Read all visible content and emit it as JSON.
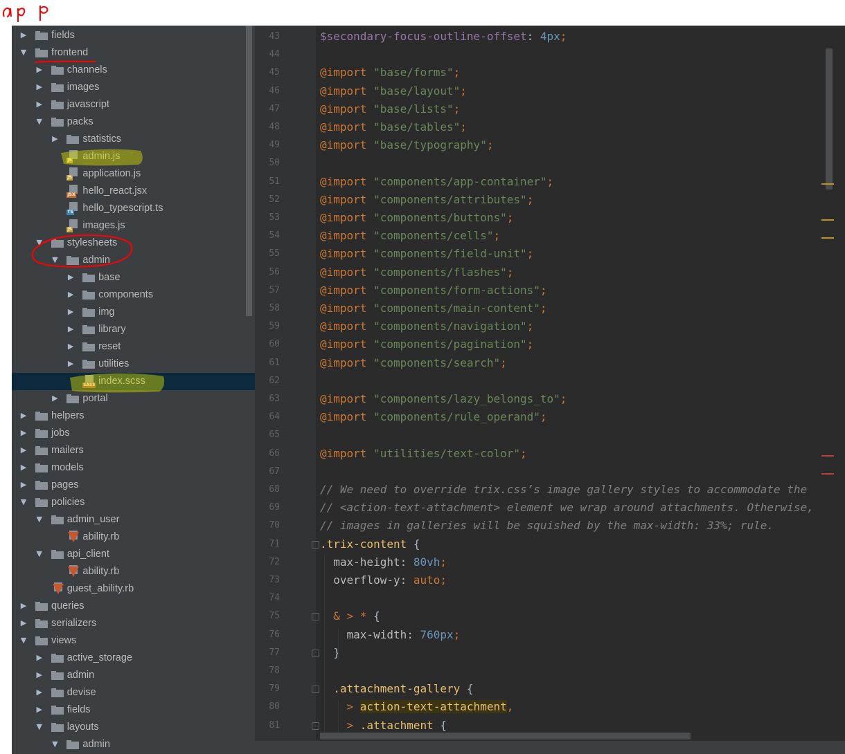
{
  "annotation": {
    "title": "app",
    "highlight_color": "#ffff00",
    "ink_color": "#ff0000"
  },
  "colors": {
    "sidebar_bg": "#3c3f41",
    "editor_bg": "#2b2b2b",
    "gutter_bg": "#313335",
    "selection_bg": "#0d293e"
  },
  "tree": [
    {
      "label": "fields",
      "depth": 0,
      "kind": "folder",
      "state": "collapsed"
    },
    {
      "label": "frontend",
      "depth": 0,
      "kind": "folder",
      "state": "expanded"
    },
    {
      "label": "channels",
      "depth": 1,
      "kind": "folder",
      "state": "collapsed"
    },
    {
      "label": "images",
      "depth": 1,
      "kind": "folder",
      "state": "collapsed"
    },
    {
      "label": "javascript",
      "depth": 1,
      "kind": "folder",
      "state": "collapsed"
    },
    {
      "label": "packs",
      "depth": 1,
      "kind": "folder",
      "state": "expanded"
    },
    {
      "label": "statistics",
      "depth": 2,
      "kind": "folder",
      "state": "collapsed"
    },
    {
      "label": "admin.js",
      "depth": 2,
      "kind": "file",
      "filetype": "JS",
      "icon": "js-file-icon",
      "highlight": true
    },
    {
      "label": "application.js",
      "depth": 2,
      "kind": "file",
      "filetype": "JS",
      "icon": "js-file-icon"
    },
    {
      "label": "hello_react.jsx",
      "depth": 2,
      "kind": "file",
      "filetype": "JSX",
      "icon": "jsx-file-icon"
    },
    {
      "label": "hello_typescript.ts",
      "depth": 2,
      "kind": "file",
      "filetype": "TS",
      "icon": "ts-file-icon"
    },
    {
      "label": "images.js",
      "depth": 2,
      "kind": "file",
      "filetype": "JS",
      "icon": "js-file-icon"
    },
    {
      "label": "stylesheets",
      "depth": 1,
      "kind": "folder",
      "state": "expanded"
    },
    {
      "label": "admin",
      "depth": 2,
      "kind": "folder",
      "state": "expanded"
    },
    {
      "label": "base",
      "depth": 3,
      "kind": "folder",
      "state": "collapsed"
    },
    {
      "label": "components",
      "depth": 3,
      "kind": "folder",
      "state": "collapsed"
    },
    {
      "label": "img",
      "depth": 3,
      "kind": "folder",
      "state": "collapsed"
    },
    {
      "label": "library",
      "depth": 3,
      "kind": "folder",
      "state": "collapsed"
    },
    {
      "label": "reset",
      "depth": 3,
      "kind": "folder",
      "state": "collapsed"
    },
    {
      "label": "utilities",
      "depth": 3,
      "kind": "folder",
      "state": "collapsed"
    },
    {
      "label": "index.scss",
      "depth": 3,
      "kind": "file",
      "filetype": "SASS",
      "icon": "sass-file-icon",
      "selected": true,
      "highlight": true
    },
    {
      "label": "portal",
      "depth": 2,
      "kind": "folder",
      "state": "collapsed"
    },
    {
      "label": "helpers",
      "depth": 0,
      "kind": "folder",
      "state": "collapsed"
    },
    {
      "label": "jobs",
      "depth": 0,
      "kind": "folder",
      "state": "collapsed"
    },
    {
      "label": "mailers",
      "depth": 0,
      "kind": "folder",
      "state": "collapsed"
    },
    {
      "label": "models",
      "depth": 0,
      "kind": "folder",
      "state": "collapsed"
    },
    {
      "label": "pages",
      "depth": 0,
      "kind": "folder",
      "state": "collapsed"
    },
    {
      "label": "policies",
      "depth": 0,
      "kind": "folder",
      "state": "expanded"
    },
    {
      "label": "admin_user",
      "depth": 1,
      "kind": "folder",
      "state": "expanded"
    },
    {
      "label": "ability.rb",
      "depth": 2,
      "kind": "file",
      "filetype": "RB",
      "icon": "ruby-file-icon"
    },
    {
      "label": "api_client",
      "depth": 1,
      "kind": "folder",
      "state": "expanded"
    },
    {
      "label": "ability.rb",
      "depth": 2,
      "kind": "file",
      "filetype": "RB",
      "icon": "ruby-file-icon"
    },
    {
      "label": "guest_ability.rb",
      "depth": 1,
      "kind": "file",
      "filetype": "RB",
      "icon": "ruby-file-icon"
    },
    {
      "label": "queries",
      "depth": 0,
      "kind": "folder",
      "state": "collapsed"
    },
    {
      "label": "serializers",
      "depth": 0,
      "kind": "folder",
      "state": "collapsed"
    },
    {
      "label": "views",
      "depth": 0,
      "kind": "folder",
      "state": "expanded"
    },
    {
      "label": "active_storage",
      "depth": 1,
      "kind": "folder",
      "state": "collapsed"
    },
    {
      "label": "admin",
      "depth": 1,
      "kind": "folder",
      "state": "collapsed"
    },
    {
      "label": "devise",
      "depth": 1,
      "kind": "folder",
      "state": "collapsed"
    },
    {
      "label": "fields",
      "depth": 1,
      "kind": "folder",
      "state": "collapsed"
    },
    {
      "label": "layouts",
      "depth": 1,
      "kind": "folder",
      "state": "expanded"
    },
    {
      "label": "admin",
      "depth": 2,
      "kind": "folder",
      "state": "expanded"
    }
  ],
  "editor": {
    "lines": [
      {
        "n": "43",
        "t": [
          [
            "var",
            "$secondary-focus-outline-offset"
          ],
          [
            "txt",
            ": "
          ],
          [
            "num",
            "4px"
          ],
          [
            "kw",
            ";"
          ]
        ]
      },
      {
        "n": "44",
        "t": []
      },
      {
        "n": "45",
        "t": [
          [
            "kw",
            "@import "
          ],
          [
            "str",
            "\"base/forms\""
          ],
          [
            "kw",
            ";"
          ]
        ]
      },
      {
        "n": "46",
        "t": [
          [
            "kw",
            "@import "
          ],
          [
            "str",
            "\"base/layout\""
          ],
          [
            "kw",
            ";"
          ]
        ]
      },
      {
        "n": "47",
        "t": [
          [
            "kw",
            "@import "
          ],
          [
            "str",
            "\"base/lists\""
          ],
          [
            "kw",
            ";"
          ]
        ]
      },
      {
        "n": "48",
        "t": [
          [
            "kw",
            "@import "
          ],
          [
            "str",
            "\"base/tables\""
          ],
          [
            "kw",
            ";"
          ]
        ]
      },
      {
        "n": "49",
        "t": [
          [
            "kw",
            "@import "
          ],
          [
            "str",
            "\"base/typography\""
          ],
          [
            "kw",
            ";"
          ]
        ]
      },
      {
        "n": "50",
        "t": []
      },
      {
        "n": "51",
        "t": [
          [
            "kw",
            "@import "
          ],
          [
            "str",
            "\"components/app-container\""
          ],
          [
            "kw",
            ";"
          ]
        ]
      },
      {
        "n": "52",
        "t": [
          [
            "kw",
            "@import "
          ],
          [
            "str",
            "\"components/attributes\""
          ],
          [
            "kw",
            ";"
          ]
        ]
      },
      {
        "n": "53",
        "t": [
          [
            "kw",
            "@import "
          ],
          [
            "str",
            "\"components/buttons\""
          ],
          [
            "kw",
            ";"
          ]
        ]
      },
      {
        "n": "54",
        "t": [
          [
            "kw",
            "@import "
          ],
          [
            "str",
            "\"components/cells\""
          ],
          [
            "kw",
            ";"
          ]
        ]
      },
      {
        "n": "55",
        "t": [
          [
            "kw",
            "@import "
          ],
          [
            "str",
            "\"components/field-unit\""
          ],
          [
            "kw",
            ";"
          ]
        ]
      },
      {
        "n": "56",
        "t": [
          [
            "kw",
            "@import "
          ],
          [
            "str",
            "\"components/flashes\""
          ],
          [
            "kw",
            ";"
          ]
        ]
      },
      {
        "n": "57",
        "t": [
          [
            "kw",
            "@import "
          ],
          [
            "str",
            "\"components/form-actions\""
          ],
          [
            "kw",
            ";"
          ]
        ]
      },
      {
        "n": "58",
        "t": [
          [
            "kw",
            "@import "
          ],
          [
            "str",
            "\"components/main-content\""
          ],
          [
            "kw",
            ";"
          ]
        ]
      },
      {
        "n": "59",
        "t": [
          [
            "kw",
            "@import "
          ],
          [
            "str",
            "\"components/navigation\""
          ],
          [
            "kw",
            ";"
          ]
        ]
      },
      {
        "n": "60",
        "t": [
          [
            "kw",
            "@import "
          ],
          [
            "str",
            "\"components/pagination\""
          ],
          [
            "kw",
            ";"
          ]
        ]
      },
      {
        "n": "61",
        "t": [
          [
            "kw",
            "@import "
          ],
          [
            "str",
            "\"components/search\""
          ],
          [
            "kw",
            ";"
          ]
        ]
      },
      {
        "n": "62",
        "t": []
      },
      {
        "n": "63",
        "t": [
          [
            "kw",
            "@import "
          ],
          [
            "str",
            "\"components/lazy_belongs_to\""
          ],
          [
            "kw",
            ";"
          ]
        ]
      },
      {
        "n": "64",
        "t": [
          [
            "kw",
            "@import "
          ],
          [
            "str",
            "\"components/rule_operand\""
          ],
          [
            "kw",
            ";"
          ]
        ]
      },
      {
        "n": "65",
        "t": []
      },
      {
        "n": "66",
        "t": [
          [
            "kw",
            "@import "
          ],
          [
            "str",
            "\"utilities/text-color\""
          ],
          [
            "kw",
            ";"
          ]
        ]
      },
      {
        "n": "67",
        "t": []
      },
      {
        "n": "68",
        "t": [
          [
            "com",
            "// We need to override trix.css’s image gallery styles to accommodate the"
          ]
        ]
      },
      {
        "n": "69",
        "t": [
          [
            "com",
            "// <action-text-attachment> element we wrap around attachments. Otherwise,"
          ]
        ]
      },
      {
        "n": "70",
        "t": [
          [
            "com",
            "// images in galleries will be squished by the max-width: 33%; rule."
          ]
        ]
      },
      {
        "n": "71",
        "t": [
          [
            "sel",
            ".trix-content"
          ],
          [
            "txt",
            " {"
          ]
        ]
      },
      {
        "n": "72",
        "t": [
          [
            "txt",
            "  "
          ],
          [
            "prop",
            "max-height"
          ],
          [
            "txt",
            ": "
          ],
          [
            "num",
            "80vh"
          ],
          [
            "kw",
            ";"
          ]
        ]
      },
      {
        "n": "73",
        "t": [
          [
            "txt",
            "  "
          ],
          [
            "prop",
            "overflow-y"
          ],
          [
            "txt",
            ": "
          ],
          [
            "kw",
            "auto"
          ],
          [
            "kw",
            ";"
          ]
        ]
      },
      {
        "n": "74",
        "t": []
      },
      {
        "n": "75",
        "t": [
          [
            "txt",
            "  "
          ],
          [
            "sym",
            "& > * "
          ],
          [
            "txt",
            "{"
          ]
        ]
      },
      {
        "n": "76",
        "t": [
          [
            "txt",
            "    "
          ],
          [
            "prop",
            "max-width"
          ],
          [
            "txt",
            ": "
          ],
          [
            "num",
            "760px"
          ],
          [
            "kw",
            ";"
          ]
        ]
      },
      {
        "n": "77",
        "t": [
          [
            "txt",
            "  }"
          ]
        ]
      },
      {
        "n": "78",
        "t": []
      },
      {
        "n": "79",
        "t": [
          [
            "txt",
            "  "
          ],
          [
            "sel",
            ".attachment-gallery"
          ],
          [
            "txt",
            " {"
          ]
        ]
      },
      {
        "n": "80",
        "t": [
          [
            "txt",
            "    "
          ],
          [
            "sym",
            "> "
          ],
          [
            "tag",
            "action-text-attachment"
          ],
          [
            "kw",
            ","
          ]
        ]
      },
      {
        "n": "81",
        "t": [
          [
            "txt",
            "    "
          ],
          [
            "sym",
            "> "
          ],
          [
            "sel",
            ".attachment"
          ],
          [
            "txt",
            " {"
          ]
        ]
      }
    ],
    "markers": [
      {
        "line": "51",
        "color": "#be9117"
      },
      {
        "line": "53",
        "color": "#be9117"
      },
      {
        "line": "54",
        "color": "#be9117"
      },
      {
        "line": "66",
        "color": "#bc3f3c"
      },
      {
        "line": "67",
        "color": "#bc3f3c"
      }
    ]
  }
}
